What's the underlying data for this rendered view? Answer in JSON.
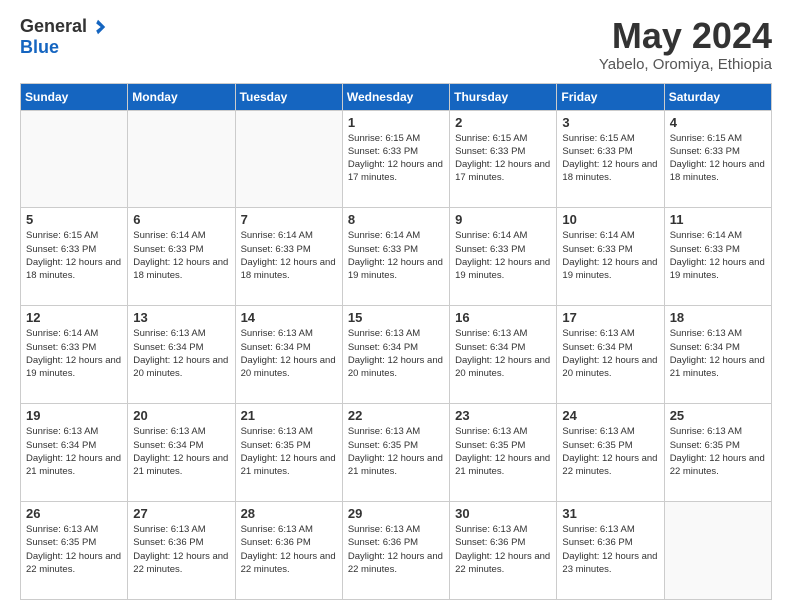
{
  "logo": {
    "general": "General",
    "blue": "Blue"
  },
  "header": {
    "month": "May 2024",
    "location": "Yabelo, Oromiya, Ethiopia"
  },
  "days_of_week": [
    "Sunday",
    "Monday",
    "Tuesday",
    "Wednesday",
    "Thursday",
    "Friday",
    "Saturday"
  ],
  "weeks": [
    [
      {
        "day": "",
        "info": ""
      },
      {
        "day": "",
        "info": ""
      },
      {
        "day": "",
        "info": ""
      },
      {
        "day": "1",
        "info": "Sunrise: 6:15 AM\nSunset: 6:33 PM\nDaylight: 12 hours\nand 17 minutes."
      },
      {
        "day": "2",
        "info": "Sunrise: 6:15 AM\nSunset: 6:33 PM\nDaylight: 12 hours\nand 17 minutes."
      },
      {
        "day": "3",
        "info": "Sunrise: 6:15 AM\nSunset: 6:33 PM\nDaylight: 12 hours\nand 18 minutes."
      },
      {
        "day": "4",
        "info": "Sunrise: 6:15 AM\nSunset: 6:33 PM\nDaylight: 12 hours\nand 18 minutes."
      }
    ],
    [
      {
        "day": "5",
        "info": "Sunrise: 6:15 AM\nSunset: 6:33 PM\nDaylight: 12 hours\nand 18 minutes."
      },
      {
        "day": "6",
        "info": "Sunrise: 6:14 AM\nSunset: 6:33 PM\nDaylight: 12 hours\nand 18 minutes."
      },
      {
        "day": "7",
        "info": "Sunrise: 6:14 AM\nSunset: 6:33 PM\nDaylight: 12 hours\nand 18 minutes."
      },
      {
        "day": "8",
        "info": "Sunrise: 6:14 AM\nSunset: 6:33 PM\nDaylight: 12 hours\nand 19 minutes."
      },
      {
        "day": "9",
        "info": "Sunrise: 6:14 AM\nSunset: 6:33 PM\nDaylight: 12 hours\nand 19 minutes."
      },
      {
        "day": "10",
        "info": "Sunrise: 6:14 AM\nSunset: 6:33 PM\nDaylight: 12 hours\nand 19 minutes."
      },
      {
        "day": "11",
        "info": "Sunrise: 6:14 AM\nSunset: 6:33 PM\nDaylight: 12 hours\nand 19 minutes."
      }
    ],
    [
      {
        "day": "12",
        "info": "Sunrise: 6:14 AM\nSunset: 6:33 PM\nDaylight: 12 hours\nand 19 minutes."
      },
      {
        "day": "13",
        "info": "Sunrise: 6:13 AM\nSunset: 6:34 PM\nDaylight: 12 hours\nand 20 minutes."
      },
      {
        "day": "14",
        "info": "Sunrise: 6:13 AM\nSunset: 6:34 PM\nDaylight: 12 hours\nand 20 minutes."
      },
      {
        "day": "15",
        "info": "Sunrise: 6:13 AM\nSunset: 6:34 PM\nDaylight: 12 hours\nand 20 minutes."
      },
      {
        "day": "16",
        "info": "Sunrise: 6:13 AM\nSunset: 6:34 PM\nDaylight: 12 hours\nand 20 minutes."
      },
      {
        "day": "17",
        "info": "Sunrise: 6:13 AM\nSunset: 6:34 PM\nDaylight: 12 hours\nand 20 minutes."
      },
      {
        "day": "18",
        "info": "Sunrise: 6:13 AM\nSunset: 6:34 PM\nDaylight: 12 hours\nand 21 minutes."
      }
    ],
    [
      {
        "day": "19",
        "info": "Sunrise: 6:13 AM\nSunset: 6:34 PM\nDaylight: 12 hours\nand 21 minutes."
      },
      {
        "day": "20",
        "info": "Sunrise: 6:13 AM\nSunset: 6:34 PM\nDaylight: 12 hours\nand 21 minutes."
      },
      {
        "day": "21",
        "info": "Sunrise: 6:13 AM\nSunset: 6:35 PM\nDaylight: 12 hours\nand 21 minutes."
      },
      {
        "day": "22",
        "info": "Sunrise: 6:13 AM\nSunset: 6:35 PM\nDaylight: 12 hours\nand 21 minutes."
      },
      {
        "day": "23",
        "info": "Sunrise: 6:13 AM\nSunset: 6:35 PM\nDaylight: 12 hours\nand 21 minutes."
      },
      {
        "day": "24",
        "info": "Sunrise: 6:13 AM\nSunset: 6:35 PM\nDaylight: 12 hours\nand 22 minutes."
      },
      {
        "day": "25",
        "info": "Sunrise: 6:13 AM\nSunset: 6:35 PM\nDaylight: 12 hours\nand 22 minutes."
      }
    ],
    [
      {
        "day": "26",
        "info": "Sunrise: 6:13 AM\nSunset: 6:35 PM\nDaylight: 12 hours\nand 22 minutes."
      },
      {
        "day": "27",
        "info": "Sunrise: 6:13 AM\nSunset: 6:36 PM\nDaylight: 12 hours\nand 22 minutes."
      },
      {
        "day": "28",
        "info": "Sunrise: 6:13 AM\nSunset: 6:36 PM\nDaylight: 12 hours\nand 22 minutes."
      },
      {
        "day": "29",
        "info": "Sunrise: 6:13 AM\nSunset: 6:36 PM\nDaylight: 12 hours\nand 22 minutes."
      },
      {
        "day": "30",
        "info": "Sunrise: 6:13 AM\nSunset: 6:36 PM\nDaylight: 12 hours\nand 22 minutes."
      },
      {
        "day": "31",
        "info": "Sunrise: 6:13 AM\nSunset: 6:36 PM\nDaylight: 12 hours\nand 23 minutes."
      },
      {
        "day": "",
        "info": ""
      }
    ]
  ]
}
